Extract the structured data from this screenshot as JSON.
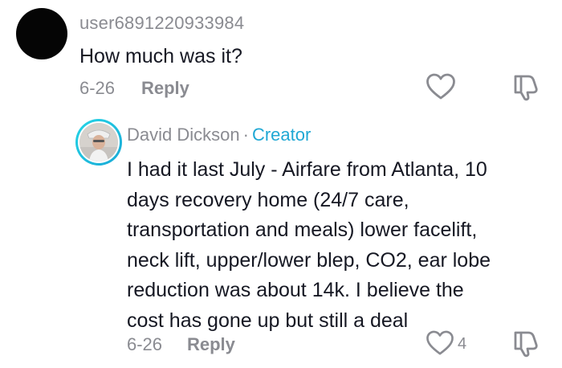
{
  "comment": {
    "username": "user6891220933984",
    "text": "How much was it?",
    "date": "6-26",
    "reply_label": "Reply"
  },
  "reply": {
    "author": "David Dickson",
    "separator": "·",
    "badge": "Creator",
    "lines": [
      "I had it last July - Airfare from Atlanta, 10",
      "days recovery home (24/7 care,",
      "transportation and meals) lower facelift,",
      "neck lift, upper/lower blep, CO2, ear lobe",
      "reduction was about 14k. I believe the",
      "cost has gone up but still a deal"
    ],
    "date": "6-26",
    "reply_label": "Reply",
    "like_count": "4"
  },
  "icons": {
    "like": "heart-outline-icon",
    "dislike": "thumbs-down-outline-icon"
  },
  "colors": {
    "text": "#161823",
    "muted": "#8a8b91",
    "creator_badge": "#20a8d4"
  }
}
